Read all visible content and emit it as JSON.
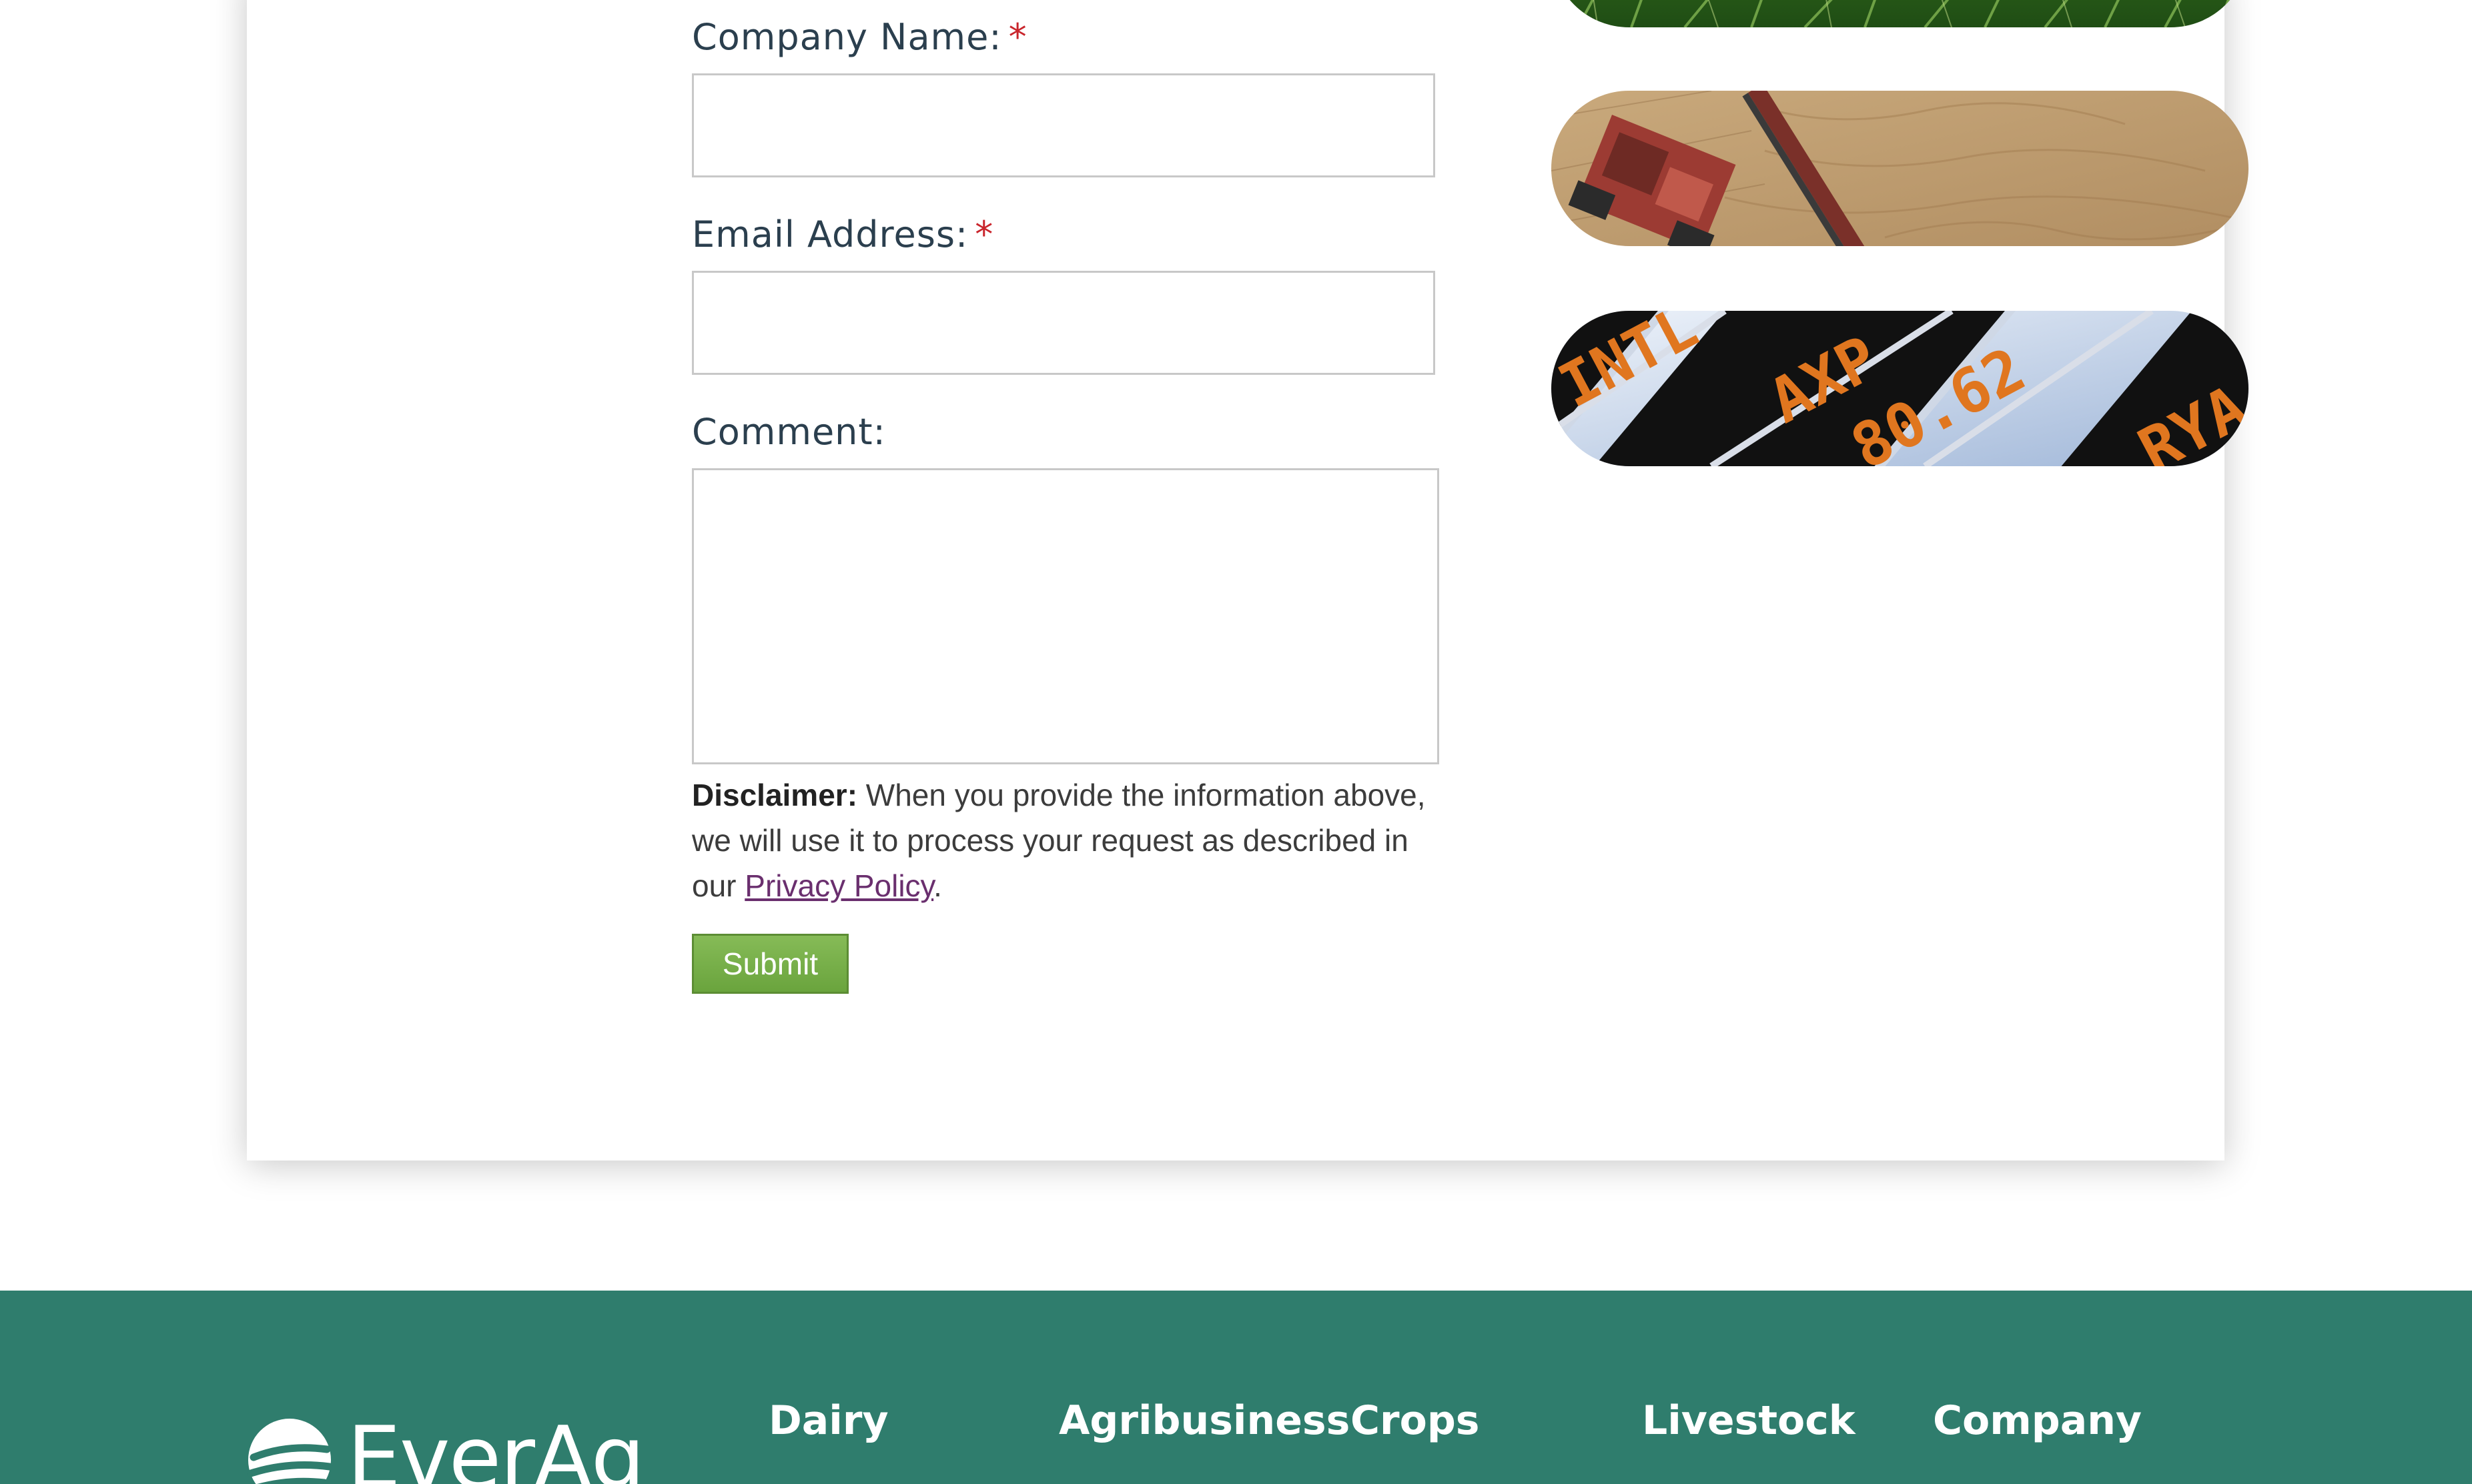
{
  "form": {
    "company_label": "Company Name:",
    "email_label": "Email Address:",
    "comment_label": "Comment:",
    "required_mark": "*",
    "disclaimer_bold": "Disclaimer:",
    "disclaimer_text": " When you provide the information above, we will use it to process your request as described in our ",
    "privacy_link": "Privacy Policy",
    "disclaimer_end": ".",
    "submit_label": "Submit"
  },
  "images": {
    "ticker_symbol": "AXP",
    "ticker_price": "80.62",
    "ticker_left": "INTL",
    "ticker_right": "RYA"
  },
  "footer": {
    "logo_text": "EverAg",
    "columns": [
      "Dairy",
      "Agribusiness",
      "Crops",
      "Livestock",
      "Company"
    ]
  },
  "colors": {
    "footer_bg": "#2f7d6d",
    "submit_bg": "#7ab24b",
    "required": "#c9252c",
    "link": "#6a2f6e"
  }
}
